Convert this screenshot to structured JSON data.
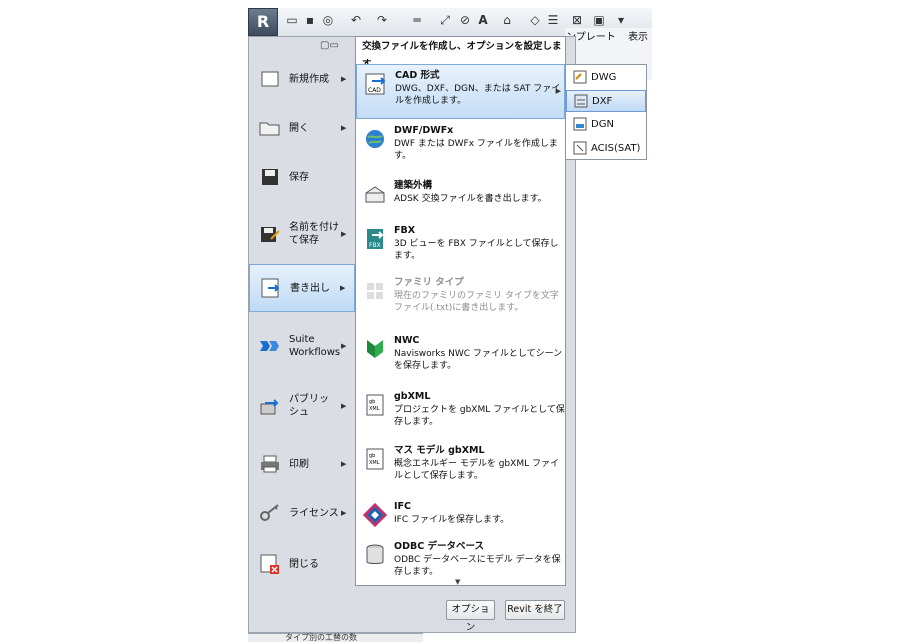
{
  "ribbon": {
    "tabs": [
      "ンプレート",
      "表示"
    ]
  },
  "left_menu": {
    "items": [
      {
        "label": "新規作成",
        "icon": "new-file-icon",
        "has_arrow": true,
        "active": false
      },
      {
        "label": "開く",
        "icon": "open-folder-icon",
        "has_arrow": true,
        "active": false
      },
      {
        "label": "保存",
        "icon": "save-icon",
        "has_arrow": false,
        "active": false
      },
      {
        "label": "名前を付け\nて保存",
        "icon": "save-as-icon",
        "has_arrow": true,
        "active": false
      },
      {
        "label": "書き出し",
        "icon": "export-icon",
        "has_arrow": true,
        "active": true
      },
      {
        "label": "Suite\nWorkflows",
        "icon": "suite-workflows-icon",
        "has_arrow": true,
        "active": false
      },
      {
        "label": "パブリッ\nシュ",
        "icon": "publish-icon",
        "has_arrow": true,
        "active": false
      },
      {
        "label": "印刷",
        "icon": "print-icon",
        "has_arrow": true,
        "active": false
      },
      {
        "label": "ライセンス",
        "icon": "license-key-icon",
        "has_arrow": true,
        "active": false
      },
      {
        "label": "閉じる",
        "icon": "close-file-icon",
        "has_arrow": false,
        "active": false
      }
    ]
  },
  "flyout": {
    "header": "交換ファイルを作成し、オプションを設定します。",
    "items": [
      {
        "title": "CAD 形式",
        "desc": "DWG、DXF、DGN、または SAT ファイルを作成します。",
        "icon": "cad-format-icon",
        "highlighted": true,
        "disabled": false
      },
      {
        "title": "DWF/DWFx",
        "desc": "DWF または DWFx ファイルを作成します。",
        "icon": "dwf-globe-icon",
        "highlighted": false,
        "disabled": false
      },
      {
        "title": "建築外構",
        "desc": "ADSK 交換ファイルを書き出します。",
        "icon": "building-site-icon",
        "highlighted": false,
        "disabled": false
      },
      {
        "title": "FBX",
        "desc": "3D ビューを FBX ファイルとして保存します。",
        "icon": "fbx-icon",
        "highlighted": false,
        "disabled": false
      },
      {
        "title": "ファミリ タイプ",
        "desc": "現在のファミリのファミリ タイプを文字ファイル(.txt)に書き出します。",
        "icon": "family-types-icon",
        "highlighted": false,
        "disabled": true
      },
      {
        "title": "NWC",
        "desc": "Navisworks NWC ファイルとしてシーンを保存します。",
        "icon": "navisworks-icon",
        "highlighted": false,
        "disabled": false
      },
      {
        "title": "gbXML",
        "desc": "プロジェクトを gbXML ファイルとして保存します。",
        "icon": "gbxml-icon",
        "highlighted": false,
        "disabled": false
      },
      {
        "title": "マス モデル gbXML",
        "desc": "概念エネルギー モデルを gbXML ファイルとして保存します。",
        "icon": "mass-model-gbxml-icon",
        "highlighted": false,
        "disabled": false
      },
      {
        "title": "IFC",
        "desc": "IFC ファイルを保存します。",
        "icon": "ifc-icon",
        "highlighted": false,
        "disabled": false
      },
      {
        "title": "ODBC データベース",
        "desc": "ODBC データベースにモデル データを保存します。",
        "icon": "database-icon",
        "highlighted": false,
        "disabled": false
      }
    ]
  },
  "submenu": {
    "items": [
      {
        "label": "DWG",
        "icon": "dwg-icon",
        "highlighted": false
      },
      {
        "label": "DXF",
        "icon": "dxf-icon",
        "highlighted": true
      },
      {
        "label": "DGN",
        "icon": "dgn-icon",
        "highlighted": false
      },
      {
        "label": "ACIS(SAT)",
        "icon": "acis-sat-icon",
        "highlighted": false
      }
    ]
  },
  "buttons": {
    "options": "オプション",
    "exit": "Revit を終了"
  },
  "bottom_text": "タイプ別の工替の数",
  "colors": {
    "highlight": "#c4dcf5",
    "menu_bg": "#d9dde3",
    "border": "#7fa9d8"
  }
}
